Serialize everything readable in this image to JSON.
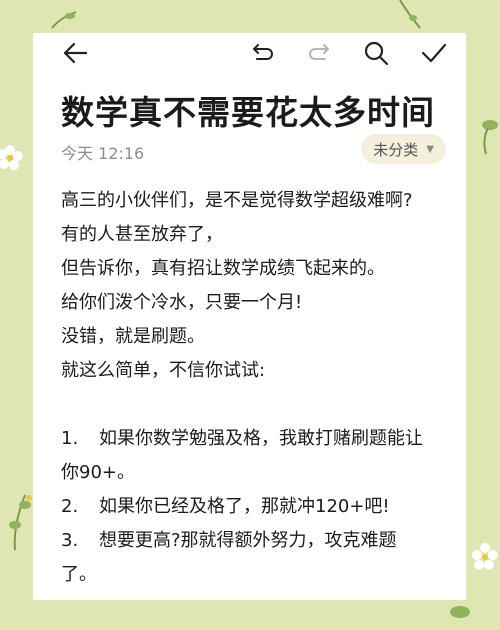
{
  "toolbar": {
    "back_icon": "back-arrow-icon",
    "undo_icon": "undo-icon",
    "redo_icon": "redo-icon",
    "search_icon": "search-icon",
    "confirm_icon": "checkmark-icon"
  },
  "note": {
    "title": "数学真不需要花太多时间",
    "date": "今天 12:16",
    "category": "未分类",
    "lines": [
      "高三的小伙伴们，是不是觉得数学超级难啊?",
      "有的人甚至放弃了，",
      "但告诉你，真有招让数学成绩飞起来的。",
      "给你们泼个冷水，只要一个月!",
      "没错，就是刷题。",
      "就这么简单，不信你试试:"
    ],
    "items": [
      {
        "num": "1.",
        "text": "如果你数学勉强及格，我敢打赌刷题能让",
        "cont": "你90+。"
      },
      {
        "num": "2.",
        "text": "如果你已经及格了，那就冲120+吧!"
      },
      {
        "num": "3.",
        "text": "想要更高?那就得额外努力，攻克难题",
        "cont": "了。"
      }
    ]
  },
  "colors": {
    "background": "#dfe6b4",
    "card": "#ffffff",
    "category_pill": "#f4f0dc"
  }
}
